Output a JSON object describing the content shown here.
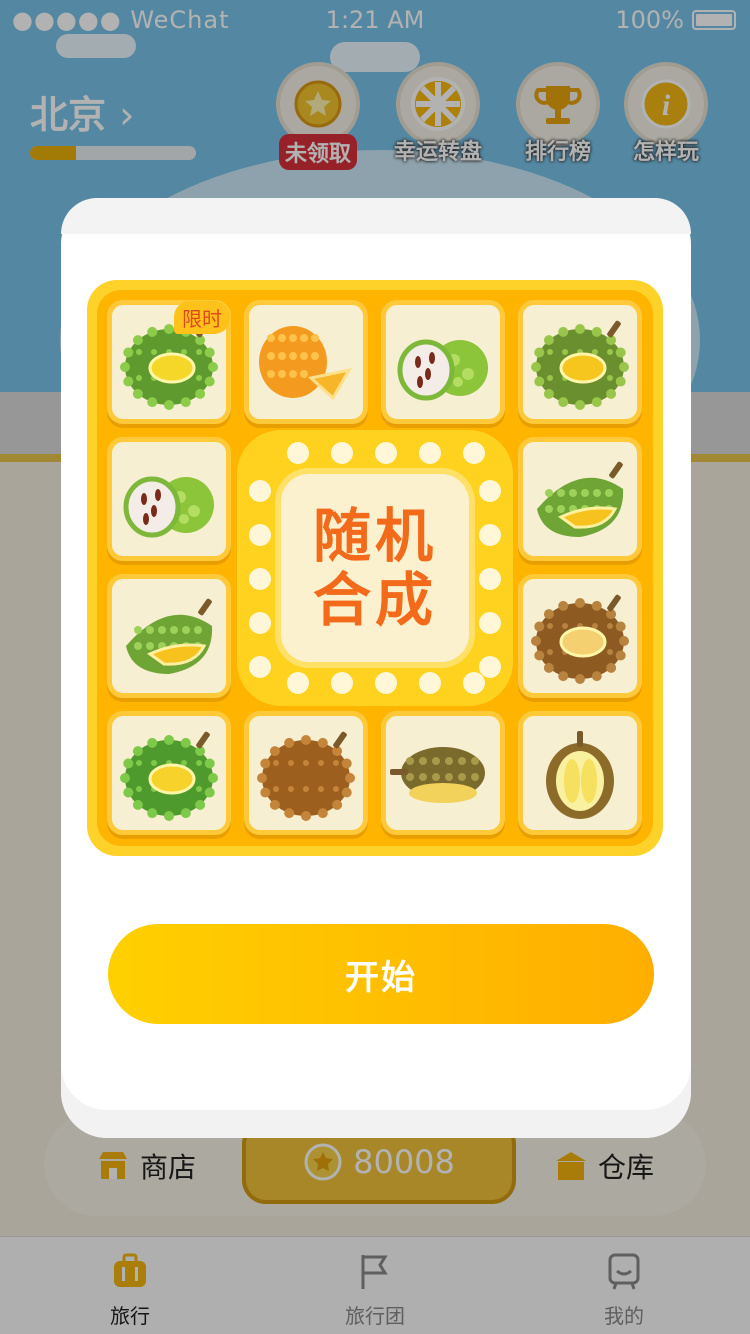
{
  "status_bar": {
    "carrier": "●●●●● WeChat",
    "time": "1:21 AM",
    "battery": "100%"
  },
  "header": {
    "city": "北京",
    "city_progress": 0.28,
    "buttons": [
      {
        "label": "未领取",
        "icon": "star-coin-icon"
      },
      {
        "label": "幸运转盘",
        "icon": "wheel-icon"
      },
      {
        "label": "排行榜",
        "icon": "trophy-icon"
      },
      {
        "label": "怎样玩",
        "icon": "info-icon"
      }
    ]
  },
  "bottom_bar": {
    "shop_label": "商店",
    "coins": "80008",
    "store_label": "仓库"
  },
  "tabs": [
    {
      "label": "旅行",
      "icon": "suitcase-icon",
      "active": true
    },
    {
      "label": "旅行团",
      "icon": "flag-icon",
      "active": false
    },
    {
      "label": "我的",
      "icon": "robot-icon",
      "active": false
    }
  ],
  "modal": {
    "badge": "限时",
    "center_text": "随机合成",
    "start_label": "开始",
    "tiles": [
      "durian-green-open",
      "durian-orange-slice",
      "soursop-green",
      "durian-yellow-open",
      "soursop-green",
      "durian-green-slice",
      "durian-green-slice",
      "durian-brown-open",
      "durian-green-whole",
      "durian-brown-whole",
      "durian-brown-half",
      "durian-pale-open"
    ]
  },
  "colors": {
    "accent": "#ffb400",
    "center_text": "#f26a1a",
    "button": "#ffc000"
  }
}
